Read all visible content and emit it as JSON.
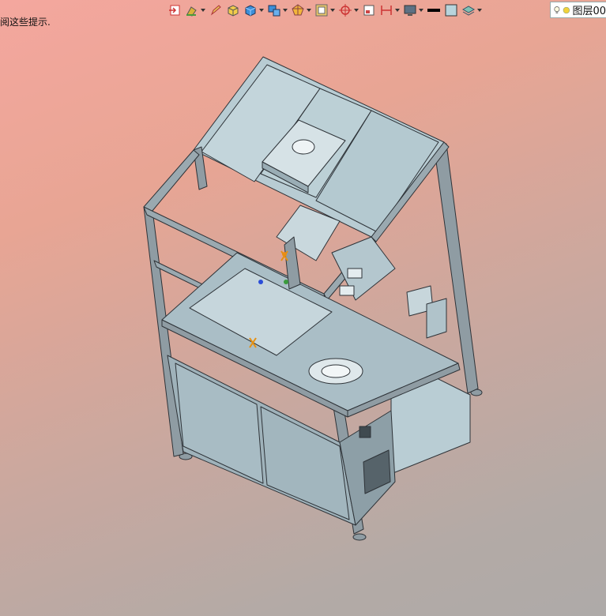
{
  "status": {
    "hint_text": "阅这些提示."
  },
  "toolbar": {
    "items": [
      {
        "icon": "export-icon",
        "has_dropdown": false
      },
      {
        "icon": "paint-icon",
        "has_dropdown": true
      },
      {
        "icon": "pencil-icon",
        "has_dropdown": false
      },
      {
        "icon": "box-yellow-icon",
        "has_dropdown": false
      },
      {
        "icon": "box-blue-icon",
        "has_dropdown": true
      },
      {
        "icon": "box-stack-icon",
        "has_dropdown": true
      },
      {
        "icon": "polygon-icon",
        "has_dropdown": true
      },
      {
        "icon": "frame-icon",
        "has_dropdown": true
      },
      {
        "icon": "crosshair-icon",
        "has_dropdown": true
      },
      {
        "icon": "page-icon",
        "has_dropdown": false
      },
      {
        "icon": "dimension-icon",
        "has_dropdown": true
      },
      {
        "icon": "monitor-icon",
        "has_dropdown": true
      },
      {
        "icon": "line-weight-icon",
        "has_dropdown": false
      },
      {
        "icon": "color-swatch-icon",
        "has_dropdown": false
      },
      {
        "icon": "layers-icon",
        "has_dropdown": true
      }
    ],
    "layer_label": "图层00"
  },
  "colors": {
    "bg_top": "#f4a79e",
    "bg_bottom": "#aeaaa8",
    "frame": "#8f9ca3",
    "panel": "#b8ccd3",
    "panel_dark": "#97aab3",
    "edge": "#2e3338"
  }
}
